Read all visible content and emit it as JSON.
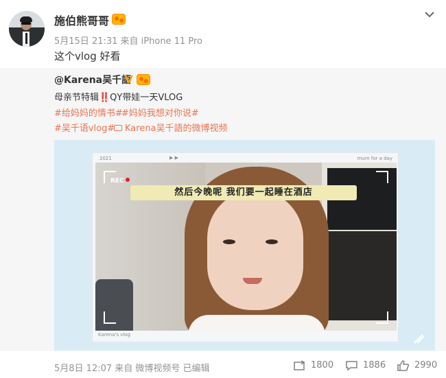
{
  "post": {
    "username": "施伯熊哥哥",
    "meta": "5月15日 21:31 来自 iPhone 11 Pro",
    "text": "这个vlog 好看"
  },
  "repost": {
    "author": "@Karena吴千語",
    "verify_mark": "V",
    "title": "母亲节特辑‼️QY带娃一天VLOG",
    "tags_line1": [
      "#给妈妈的情书#",
      "#妈妈我想对你说#"
    ],
    "tag_line2": "#吴千语vlog#",
    "video_link": "Karena吴千語的微博视频"
  },
  "video": {
    "year": "2021",
    "ticks": "▶ ▶",
    "mum_label": "mum for a day",
    "vlog_label": "Karena's vlog",
    "rec": "REC",
    "subtitle": "然后今晚呢 我们要一起睡在酒店"
  },
  "footer": {
    "meta": "5月8日 12:07 来自 微博视频号 已编辑",
    "reposts": "1800",
    "comments": "1886",
    "likes": "2990"
  },
  "colors": {
    "tag": "#eb7350",
    "meta": "#939393",
    "video_bg": "#d9ecf6",
    "subtitle_bg": "#f0eab4"
  }
}
